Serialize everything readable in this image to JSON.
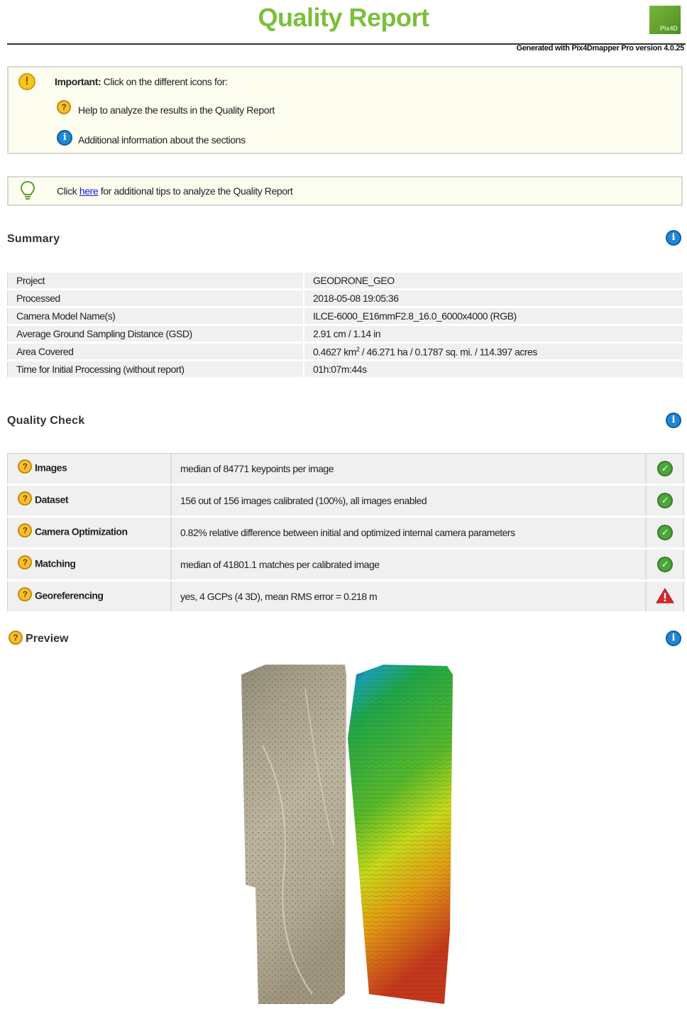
{
  "header": {
    "title": "Quality Report",
    "generated": "Generated with Pix4Dmapper Pro version 4.0.25",
    "logo_text": "Pix4D"
  },
  "notice": {
    "important_label": "Important:",
    "important_text": "Click on the different icons for:",
    "help_text": "Help to analyze the results in the Quality Report",
    "info_text": "Additional information about the sections"
  },
  "tip": {
    "prefix": "Click ",
    "link": "here",
    "suffix": " for additional tips to analyze the Quality Report"
  },
  "summary": {
    "title": "Summary",
    "rows": [
      {
        "key": "Project",
        "value": "GEODRONE_GEO"
      },
      {
        "key": "Processed",
        "value": "2018-05-08 19:05:36"
      },
      {
        "key": "Camera Model Name(s)",
        "value": "ILCE-6000_E16mmF2.8_16.0_6000x4000 (RGB)"
      },
      {
        "key": "Average Ground Sampling Distance (GSD)",
        "value": "2.91 cm / 1.14 in"
      },
      {
        "key": "Area Covered",
        "value_a": "0.4627 km",
        "value_sup": "2",
        "value_b": " / 46.271 ha / 0.1787 sq. mi. / 114.397 acres"
      },
      {
        "key": "Time for Initial Processing (without report)",
        "value": "01h:07m:44s"
      }
    ]
  },
  "quality_check": {
    "title": "Quality Check",
    "rows": [
      {
        "name": "Images",
        "desc": "median of 84771 keypoints per image",
        "status": "ok"
      },
      {
        "name": "Dataset",
        "desc": "156 out of 156 images calibrated (100%), all images enabled",
        "status": "ok"
      },
      {
        "name": "Camera Optimization",
        "desc": "0.82% relative difference between initial and optimized internal camera parameters",
        "status": "ok"
      },
      {
        "name": "Matching",
        "desc": "median of 41801.1 matches per calibrated image",
        "status": "ok"
      },
      {
        "name": "Georeferencing",
        "desc": "yes, 4 GCPs (4 3D), mean RMS error = 0.218 m",
        "status": "warning"
      }
    ]
  },
  "preview": {
    "title": "Preview"
  },
  "colors": {
    "title_green": "#7bbf3a",
    "ok_green": "#4fa43a",
    "warning_red": "#d9262c",
    "info_blue": "#1e88d6",
    "help_yellow": "#f7c12d"
  }
}
